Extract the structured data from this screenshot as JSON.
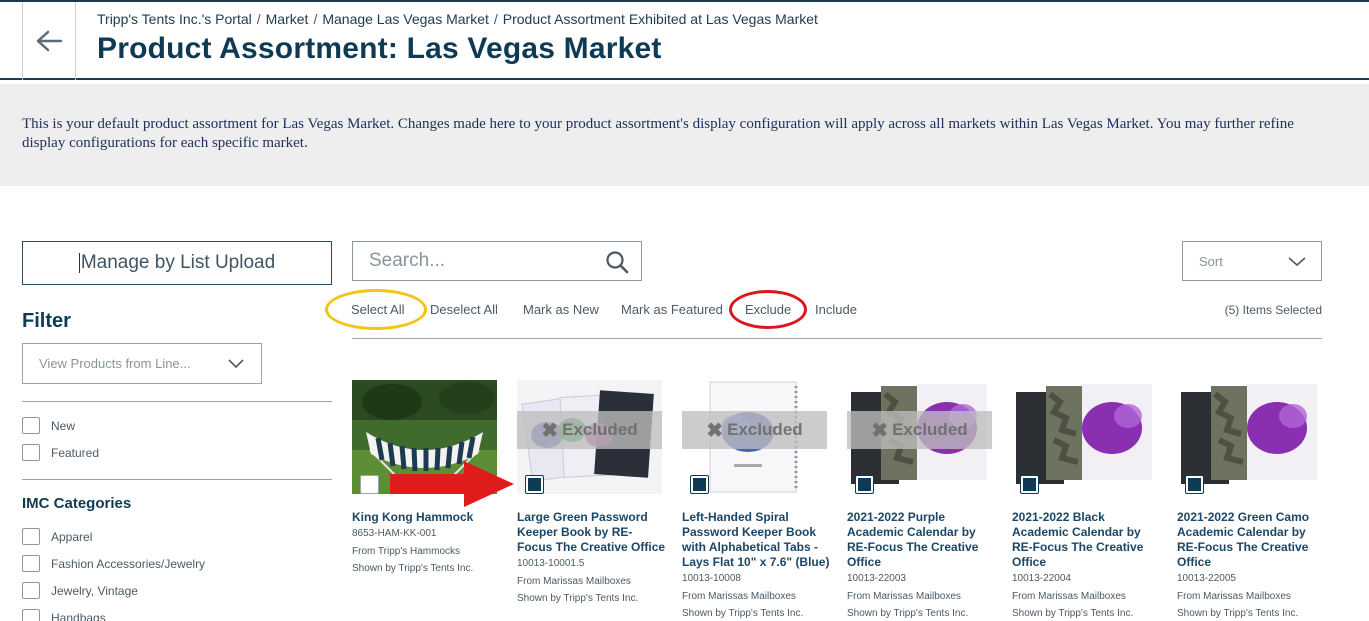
{
  "breadcrumb": {
    "items": [
      "Tripp's Tents Inc.'s Portal",
      "Market",
      "Manage Las Vegas Market",
      "Product Assortment Exhibited at Las Vegas Market"
    ],
    "separator": "/"
  },
  "page_title": "Product Assortment: Las Vegas Market",
  "banner_text": "This is your default product assortment for Las Vegas Market. Changes made here to your product assortment's display configuration will apply across all markets within Las Vegas Market. You may further refine display configurations for each specific market.",
  "sidebar": {
    "list_upload_label": "Manage by List Upload",
    "filter_title": "Filter",
    "line_select_placeholder": "View Products from Line...",
    "flags": [
      "New",
      "Featured"
    ],
    "categories_title": "IMC Categories",
    "categories": [
      "Apparel",
      "Fashion Accessories/Jewelry",
      "Jewelry, Vintage",
      "Handbags"
    ]
  },
  "toolbar": {
    "search_placeholder": "Search...",
    "sort_label": "Sort",
    "actions": {
      "select_all": "Select All",
      "deselect_all": "Deselect All",
      "mark_new": "Mark as New",
      "mark_featured": "Mark as Featured",
      "exclude": "Exclude",
      "include": "Include"
    },
    "items_selected": "(5) Items Selected"
  },
  "products": [
    {
      "name": "King Kong Hammock",
      "sku": "8653-HAM-KK-001",
      "from": "From Tripp's Hammocks",
      "shown_by": "Shown by Tripp's Tents Inc.",
      "selected": false,
      "excluded": false
    },
    {
      "name": "Large Green Password Keeper Book by RE-Focus The Creative Office",
      "sku": "10013-10001.5",
      "from": "From Marissas Mailboxes",
      "shown_by": "Shown by Tripp's Tents Inc.",
      "selected": true,
      "excluded": true
    },
    {
      "name": "Left-Handed Spiral Password Keeper Book with Alphabetical Tabs - Lays Flat 10\" x 7.6\" (Blue)",
      "sku": "10013-10008",
      "from": "From Marissas Mailboxes",
      "shown_by": "Shown by Tripp's Tents Inc.",
      "selected": true,
      "excluded": true
    },
    {
      "name": "2021-2022 Purple Academic Calendar by RE-Focus The Creative Office",
      "sku": "10013-22003",
      "from": "From Marissas Mailboxes",
      "shown_by": "Shown by Tripp's Tents Inc.",
      "selected": true,
      "excluded": true
    },
    {
      "name": "2021-2022 Black Academic Calendar by RE-Focus The Creative Office",
      "sku": "10013-22004",
      "from": "From Marissas Mailboxes",
      "shown_by": "Shown by Tripp's Tents Inc.",
      "selected": true,
      "excluded": false
    },
    {
      "name": "2021-2022 Green Camo Academic Calendar by RE-Focus The Creative Office",
      "sku": "10013-22005",
      "from": "From Marissas Mailboxes",
      "shown_by": "Shown by Tripp's Tents Inc.",
      "selected": true,
      "excluded": false
    }
  ],
  "excluded_label": "Excluded",
  "colors": {
    "brand_navy": "#0f3a54",
    "highlight_yellow": "#f2c418",
    "highlight_red": "#d8171d",
    "banner_bg": "#eeeeee"
  },
  "icons": [
    "back-arrow-icon",
    "search-icon",
    "chevron-down-icon",
    "close-x-icon"
  ]
}
